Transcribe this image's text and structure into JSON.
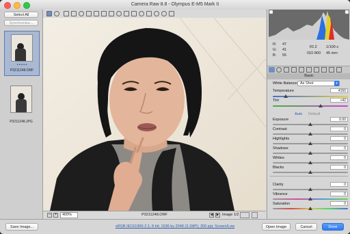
{
  "window": {
    "title": "Camera Raw 8.8  -  Olympus E-M5 Mark II"
  },
  "filmstrip": {
    "select_all": "Select All",
    "synchronize": "Synchronize...",
    "items": [
      {
        "filename": "P3211248.ORF",
        "rating": "• • • • •"
      },
      {
        "filename": "P3211248.JPG"
      }
    ]
  },
  "preview": {
    "zoom": "400%",
    "filename": "P3211248.ORF",
    "image_index": "Image 1/2"
  },
  "info": {
    "r_label": "R:",
    "r_value": "47",
    "g_label": "G:",
    "g_value": "41",
    "b_label": "B:",
    "b_value": "55",
    "aperture": "f/2.2",
    "shutter": "1/100 s",
    "iso": "ISO 800",
    "focal": "45 mm"
  },
  "panel": {
    "title": "Basic",
    "white_balance_label": "White Balance:",
    "white_balance_value": "As Shot",
    "auto_label": "Auto",
    "default_label": "Default",
    "temperature": {
      "label": "Temperature",
      "value": "4150",
      "level": 0.17
    },
    "tint": {
      "label": "Tint",
      "value": "+42",
      "level": 0.64
    },
    "adjustments": [
      {
        "label": "Exposure",
        "value": "0.00",
        "level": 0.5
      },
      {
        "label": "Contrast",
        "value": "0",
        "level": 0.5
      },
      {
        "label": "Highlights",
        "value": "0",
        "level": 0.5
      },
      {
        "label": "Shadows",
        "value": "0",
        "level": 0.5
      },
      {
        "label": "Whites",
        "value": "0",
        "level": 0.5
      },
      {
        "label": "Blacks",
        "value": "0",
        "level": 0.5
      }
    ],
    "presence": [
      {
        "label": "Clarity",
        "value": "0",
        "level": 0.5
      },
      {
        "label": "Vibrance",
        "value": "0",
        "level": 0.5
      },
      {
        "label": "Saturation",
        "value": "0",
        "level": 0.5
      }
    ]
  },
  "footer": {
    "save_image": "Save Image...",
    "workflow_link": "sRGB IEC61966-2.1; 8 bit; 1536 by 2048 (3.1MP); 300 ppi; Screen/Low",
    "open_image": "Open Image",
    "cancel": "Cancel",
    "done": "Done"
  },
  "colors": {
    "accent": "#2f7bf0",
    "selection": "#a9b9d4"
  }
}
